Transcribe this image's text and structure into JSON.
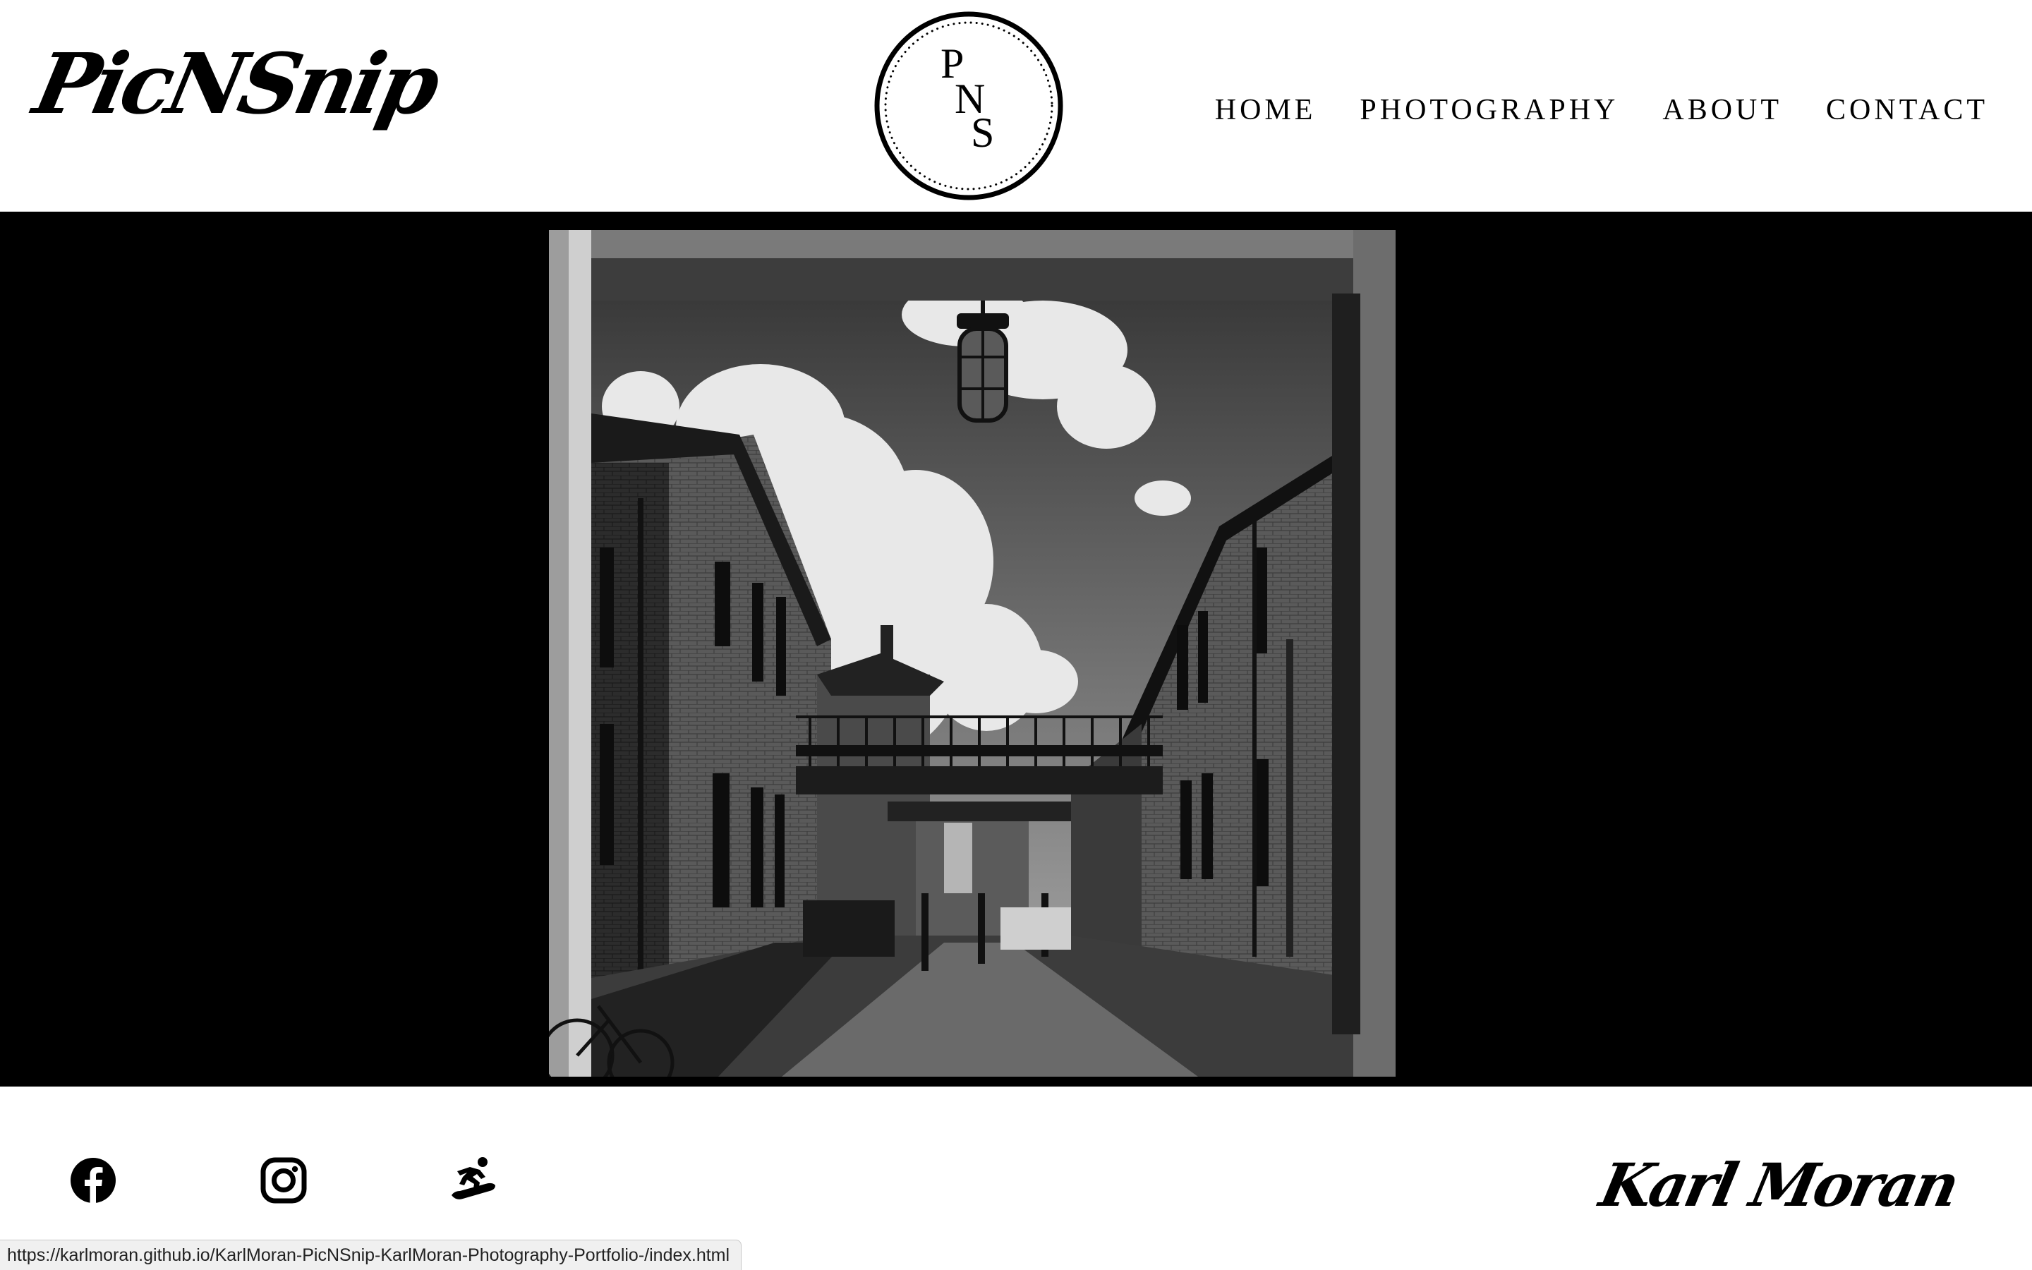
{
  "header": {
    "brand": "PicNSnip",
    "monogram": {
      "letters": [
        "P",
        "N",
        "S"
      ]
    },
    "nav": [
      {
        "label": "HOME"
      },
      {
        "label": "PHOTOGRAPHY"
      },
      {
        "label": "ABOUT"
      },
      {
        "label": "CONTACT"
      }
    ]
  },
  "hero": {
    "image": "black-and-white photograph of brick buildings and a footbridge viewed through an archway"
  },
  "footer": {
    "social_icons": [
      "facebook-icon",
      "instagram-icon",
      "snowboarder-icon"
    ],
    "signature": "Karl Moran"
  },
  "status_bar": {
    "url": "https://karlmoran.github.io/KarlMoran-PicNSnip-KarlMoran-Photography-Portfolio-/index.html"
  },
  "colors": {
    "background": "#ffffff",
    "hero_background": "#000000",
    "text": "#000000"
  }
}
